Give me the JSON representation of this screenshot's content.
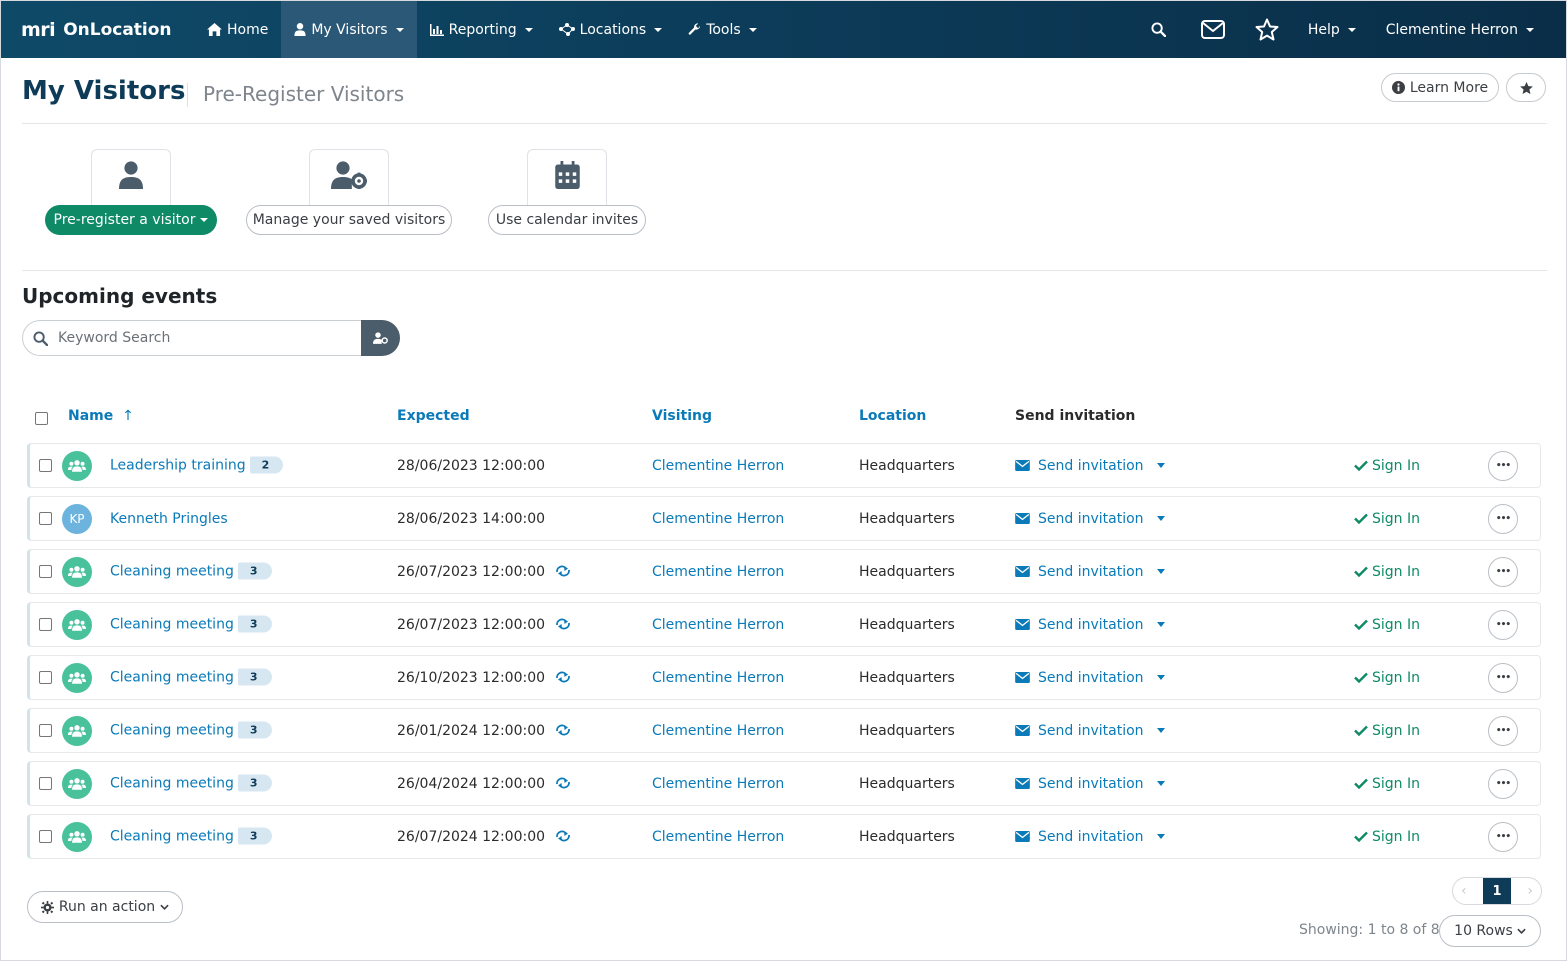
{
  "nav": {
    "logo_text": "mri",
    "brand": "OnLocation",
    "items": [
      {
        "label": "Home",
        "icon": "home-icon"
      },
      {
        "label": "My Visitors",
        "icon": "user-icon",
        "active": true
      },
      {
        "label": "Reporting",
        "icon": "bar-chart-icon"
      },
      {
        "label": "Locations",
        "icon": "nodes-icon"
      },
      {
        "label": "Tools",
        "icon": "wrench-icon"
      }
    ],
    "help": "Help",
    "user": "Clementine Herron"
  },
  "header": {
    "title": "My Visitors",
    "subtitle": "Pre-Register Visitors",
    "learn_more": "Learn More"
  },
  "tiles": [
    {
      "label": "Pre-register a visitor",
      "icon": "user-icon"
    },
    {
      "label": "Manage your saved visitors",
      "icon": "user-gear-icon"
    },
    {
      "label": "Use calendar invites",
      "icon": "calendar-icon"
    }
  ],
  "upcoming": {
    "title": "Upcoming events",
    "search_placeholder": "Keyword Search"
  },
  "table": {
    "columns": {
      "name": "Name",
      "name_sort": "↑",
      "expected": "Expected",
      "visiting": "Visiting",
      "location": "Location",
      "send": "Send invitation"
    },
    "rows": [
      {
        "type": "group",
        "initials": "",
        "name": "Leadership training",
        "count": "2",
        "expected": "28/06/2023 12:00:00",
        "recurring": false,
        "visiting": "Clementine Herron",
        "location": "Headquarters",
        "send": "Send invitation",
        "action": "Sign In",
        "more": "•••"
      },
      {
        "type": "person",
        "initials": "KP",
        "name": "Kenneth Pringles",
        "count": "",
        "expected": "28/06/2023 14:00:00",
        "recurring": false,
        "visiting": "Clementine Herron",
        "location": "Headquarters",
        "send": "Send invitation",
        "action": "Sign In",
        "more": "•••"
      },
      {
        "type": "group",
        "initials": "",
        "name": "Cleaning meeting",
        "count": "3",
        "expected": "26/07/2023 12:00:00",
        "recurring": true,
        "visiting": "Clementine Herron",
        "location": "Headquarters",
        "send": "Send invitation",
        "action": "Sign In",
        "more": "•••"
      },
      {
        "type": "group",
        "initials": "",
        "name": "Cleaning meeting",
        "count": "3",
        "expected": "26/07/2023 12:00:00",
        "recurring": true,
        "visiting": "Clementine Herron",
        "location": "Headquarters",
        "send": "Send invitation",
        "action": "Sign In",
        "more": "•••"
      },
      {
        "type": "group",
        "initials": "",
        "name": "Cleaning meeting",
        "count": "3",
        "expected": "26/10/2023 12:00:00",
        "recurring": true,
        "visiting": "Clementine Herron",
        "location": "Headquarters",
        "send": "Send invitation",
        "action": "Sign In",
        "more": "•••"
      },
      {
        "type": "group",
        "initials": "",
        "name": "Cleaning meeting",
        "count": "3",
        "expected": "26/01/2024 12:00:00",
        "recurring": true,
        "visiting": "Clementine Herron",
        "location": "Headquarters",
        "send": "Send invitation",
        "action": "Sign In",
        "more": "•••"
      },
      {
        "type": "group",
        "initials": "",
        "name": "Cleaning meeting",
        "count": "3",
        "expected": "26/04/2024 12:00:00",
        "recurring": true,
        "visiting": "Clementine Herron",
        "location": "Headquarters",
        "send": "Send invitation",
        "action": "Sign In",
        "more": "•••"
      },
      {
        "type": "group",
        "initials": "",
        "name": "Cleaning meeting",
        "count": "3",
        "expected": "26/07/2024 12:00:00",
        "recurring": true,
        "visiting": "Clementine Herron",
        "location": "Headquarters",
        "send": "Send invitation",
        "action": "Sign In",
        "more": "•••"
      }
    ]
  },
  "footer": {
    "run_action": "Run an action",
    "page": "1",
    "showing": "Showing: 1 to 8 of 8",
    "rows": "10 Rows"
  },
  "colors": {
    "nav_bg": "#0c3a57",
    "link": "#0a7ab8",
    "primary_green": "#0e8a66",
    "avatar_group": "#49c19a",
    "avatar_person": "#6cb4dd",
    "title_navy": "#0e3b57"
  }
}
